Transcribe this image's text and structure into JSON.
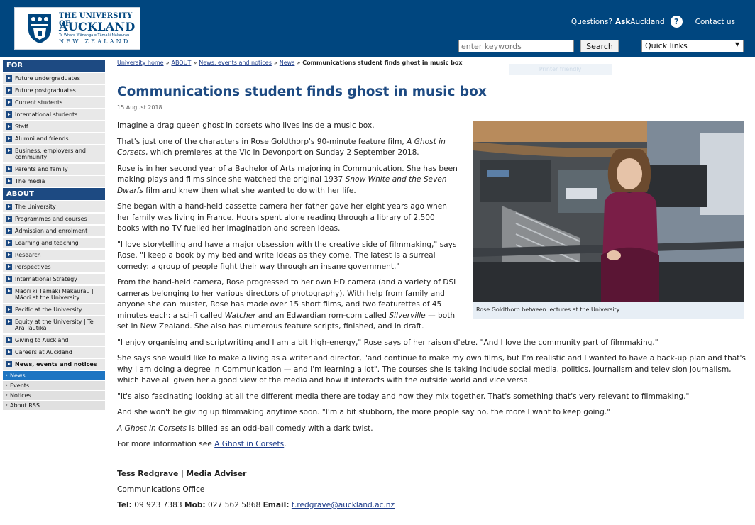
{
  "header": {
    "logo": {
      "line1": "THE UNIVERSITY OF",
      "line2": "AUCKLAND",
      "line3": "Te Whare Wānanga o Tāmaki Makaurau",
      "line4": "NEW ZEALAND"
    },
    "questions_text": "Questions?",
    "ask_text": "Ask",
    "auckland_text": "Auckland",
    "help_icon": "?",
    "contact_label": "Contact us",
    "search_placeholder": "enter keywords",
    "search_button": "Search",
    "quick_links": "Quick links"
  },
  "sidebar": {
    "for_heading": "FOR",
    "for_items": [
      {
        "label": "Future undergraduates"
      },
      {
        "label": "Future postgraduates"
      },
      {
        "label": "Current students"
      },
      {
        "label": "International students"
      },
      {
        "label": "Staff"
      },
      {
        "label": "Alumni and friends"
      },
      {
        "label": "Business, employers and community"
      },
      {
        "label": "Parents and family"
      },
      {
        "label": "The media"
      }
    ],
    "about_heading": "ABOUT",
    "about_items": [
      {
        "label": "The University"
      },
      {
        "label": "Programmes and courses"
      },
      {
        "label": "Admission and enrolment"
      },
      {
        "label": "Learning and teaching"
      },
      {
        "label": "Research"
      },
      {
        "label": "Perspectives"
      },
      {
        "label": "International Strategy"
      },
      {
        "label": "Māori ki Tāmaki Makaurau | Māori at the University"
      },
      {
        "label": "Pacific at the University"
      },
      {
        "label": "Equity at the University | Te Ara Tautika"
      },
      {
        "label": "Giving to Auckland"
      },
      {
        "label": "Careers at Auckland"
      },
      {
        "label": "News, events and notices"
      }
    ],
    "sub_items": [
      {
        "label": "News"
      },
      {
        "label": "Events"
      },
      {
        "label": "Notices"
      },
      {
        "label": "About RSS"
      }
    ]
  },
  "breadcrumb": {
    "items": [
      "University home",
      "ABOUT",
      "News, events and notices",
      "News"
    ],
    "separator": "»",
    "current": "Communications student finds ghost in music box"
  },
  "faint_bar": "Printer friendly",
  "article": {
    "title": "Communications student finds ghost in music box",
    "date": "15 August 2018",
    "caption": "Rose Goldthorp between lectures at the University.",
    "p1": "Imagine a drag queen ghost in corsets who lives inside a music box.",
    "p2a": "That's just one of the characters in Rose Goldthorp's 90-minute feature film,",
    "p2b": "A Ghost in Corsets",
    "p2c": ", which premieres at the Vic in Devonport on Sunday 2 September 2018.",
    "p3a": "Rose is in her second year of a Bachelor of Arts majoring in Communication. She has been making plays and films since she watched the original 1937",
    "p3b": "Snow White and the Seven Dwarfs",
    "p3c": "film and knew then what she wanted to do with her life.",
    "p4": "She began with a hand-held cassette camera her father gave her eight years ago when her family was living in France. Hours spent alone reading through a library of 2,500 books with no TV fuelled her imagination and screen ideas.",
    "p5": "\"I love storytelling and have a major obsession with the creative side of filmmaking,\" says Rose. \"I keep a book by my bed and write ideas as they come. The latest is a surreal comedy: a group of people fight their way through an insane government.\"",
    "p6a": "From the hand-held camera, Rose progressed to her own HD camera (and a variety of DSL cameras belonging to her various directors of photography). With help from family and anyone she can muster, Rose has made over 15 short films, and two featurettes of 45 minutes each: a sci-fi called",
    "p6b": "Watcher",
    "p6c": "and an Edwardian rom-com called",
    "p6d": "Silverville",
    "p6e": "— both set in New Zealand. She also has numerous feature scripts, finished, and in draft.",
    "p7": "\"I enjoy organising and scriptwriting and I am a bit high-energy,\" Rose says of her raison d'etre. \"And I love the community part of filmmaking.\"",
    "p8": "She says she would like to make a living as a writer and director, \"and continue to make my own films, but I'm realistic and I wanted to have a back-up plan and that's why I am doing a degree in Communication — and I'm learning a lot\". The courses she is taking include social media, politics, journalism and television journalism, which have all given her a good view of the media and how it interacts with the outside world and vice versa.",
    "p9": "\"It's also fascinating looking at all the different media there are today and how they mix together. That's something that's very relevant to filmmaking.\"",
    "p10": "And she won't be giving up filmmaking anytime soon. \"I'm a bit stubborn, the more people say no, the more I want to keep going.\"",
    "p11a": "A Ghost in Corsets",
    "p11b": "is billed as an odd-ball comedy with a dark twist.",
    "p12a": "For more information see",
    "p12_link": "A Ghost in Corsets",
    "p12b": "."
  },
  "contact": {
    "name_line": "Tess Redgrave | Media Adviser",
    "office": "Communications Office",
    "tel_label": "Tel:",
    "tel": "09 923 7383",
    "mob_label": "Mob:",
    "mob": "027 562 5868",
    "email_label": "Email:",
    "email": "t.redgrave@auckland.ac.nz"
  },
  "colors": {
    "brand_blue": "#00467f",
    "nav_heading": "#1d4a82",
    "active_nav": "#1e75c2",
    "link": "#1f3d8a"
  }
}
